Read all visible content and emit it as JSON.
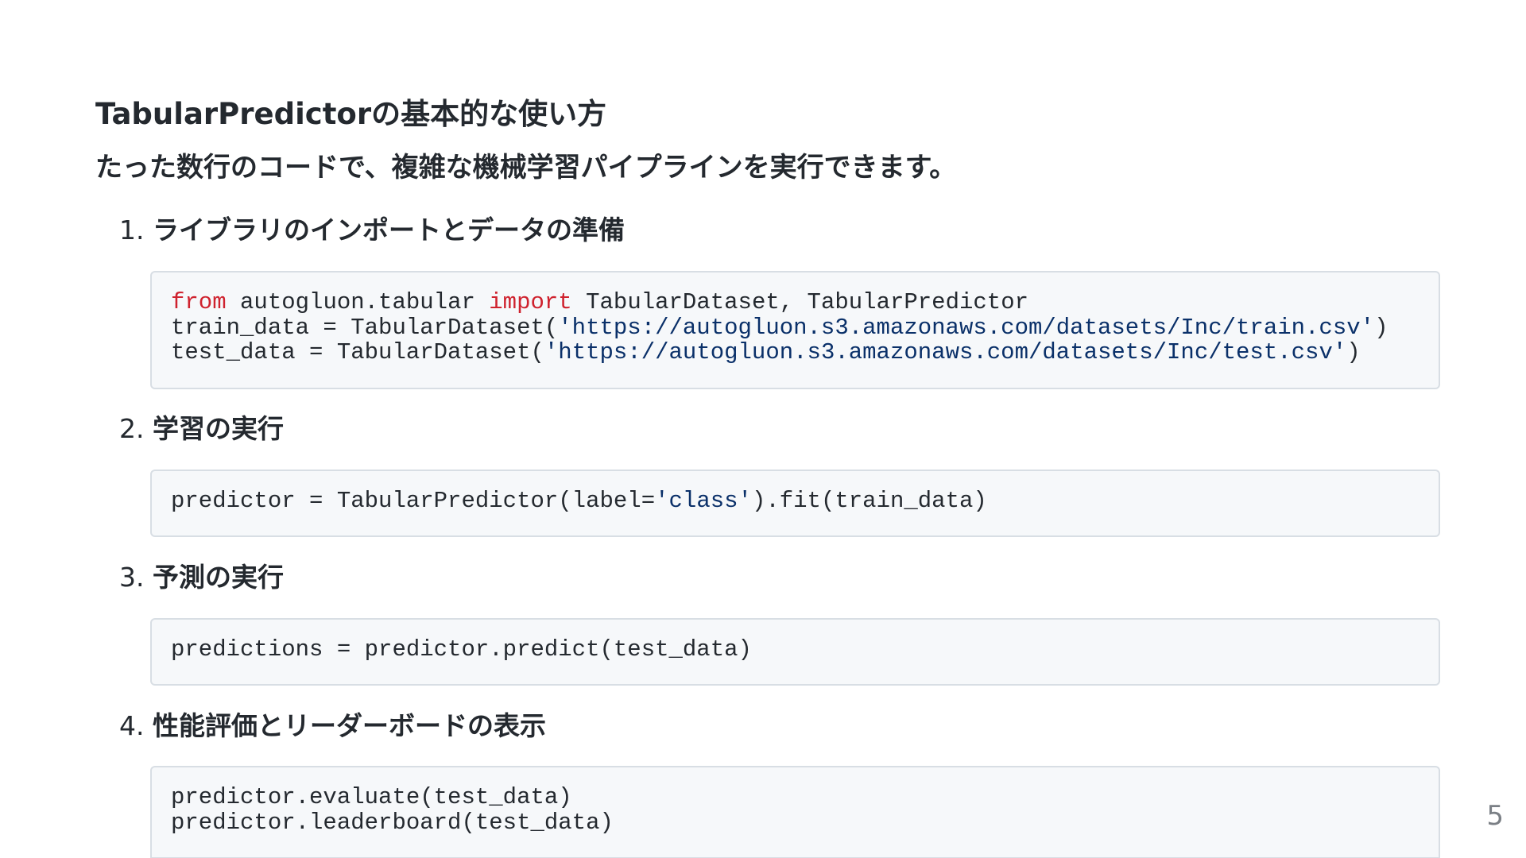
{
  "slide": {
    "title": "TabularPredictorの基本的な使い方",
    "subtitle": "たった数行のコードで、複雑な機械学習パイプラインを実行できます。",
    "page_number": "5"
  },
  "steps": [
    {
      "number": "1.",
      "heading": "ライブラリのインポートとデータの準備",
      "code": {
        "line1_kw1": "from",
        "line1_mid": " autogluon.tabular ",
        "line1_kw2": "import",
        "line1_end": " TabularDataset, TabularPredictor",
        "line2_pre": "train_data = TabularDataset(",
        "line2_str": "'https://autogluon.s3.amazonaws.com/datasets/Inc/train.csv'",
        "line2_post": ")",
        "line3_pre": "test_data = TabularDataset(",
        "line3_str": "'https://autogluon.s3.amazonaws.com/datasets/Inc/test.csv'",
        "line3_post": ")"
      }
    },
    {
      "number": "2.",
      "heading": "学習の実行",
      "code": {
        "line1_pre": "predictor = TabularPredictor(label=",
        "line1_str": "'class'",
        "line1_post": ").fit(train_data)"
      }
    },
    {
      "number": "3.",
      "heading": "予測の実行",
      "code": {
        "line1": "predictions = predictor.predict(test_data)"
      }
    },
    {
      "number": "4.",
      "heading": "性能評価とリーダーボードの表示",
      "code": {
        "line1": "predictor.evaluate(test_data)",
        "line2": "predictor.leaderboard(test_data)"
      }
    }
  ],
  "colors": {
    "keyword": "#cf222e",
    "string": "#0a3069",
    "code_background": "#f6f8fa",
    "code_border": "#d8dee4",
    "text": "#24292f"
  }
}
